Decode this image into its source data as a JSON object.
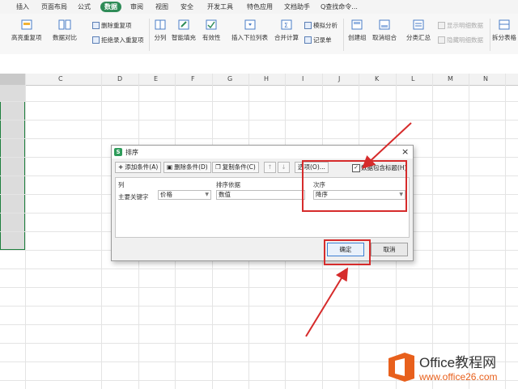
{
  "menu": {
    "items": [
      "插入",
      "页面布局",
      "公式",
      "数据",
      "审阅",
      "视图",
      "安全",
      "开发工具",
      "特色应用",
      "文档助手",
      "Q查找命令..."
    ],
    "active_index": 3
  },
  "ribbon": {
    "highlight_dup": "高亮重复项",
    "data_compare": "数据对比",
    "delete_dup": "删除重复项",
    "reject_dup": "拒绝录入重复项",
    "split": "分列",
    "smart_fill": "智能填充",
    "validity": "有效性",
    "insert_dropdown": "插入下拉列表",
    "merge_calc": "合并计算",
    "simulate": "模拟分析",
    "record": "记录单",
    "create_group": "创建组",
    "ungroup": "取消组合",
    "subtotal": "分类汇总",
    "show_detail": "显示明细数据",
    "hide_detail": "隐藏明细数据",
    "split_table": "拆分表格"
  },
  "columns": [
    "C",
    "D",
    "E",
    "F",
    "G",
    "H",
    "I",
    "J",
    "K",
    "L",
    "M",
    "N"
  ],
  "dialog": {
    "title": "排序",
    "logo": "S",
    "close": "×",
    "buttons": {
      "add": "添加条件(A)",
      "delete": "删除条件(D)",
      "copy": "复制条件(C)",
      "up": "↑",
      "down": "↓",
      "options": "选项(O)...",
      "header_checkbox": "数据包含标题(H)"
    },
    "headers": {
      "col": "列",
      "basis": "排序依据",
      "order": "次序"
    },
    "row": {
      "key_label": "主要关键字",
      "key_value": "价格",
      "basis_value": "数值",
      "order_value": "降序"
    },
    "ok": "确定",
    "cancel": "取消"
  },
  "watermark": {
    "brand": "Office教程网",
    "url": "www.office26.com"
  },
  "colors": {
    "active_tab": "#2e8b57",
    "annotation": "#d62b2b",
    "selection_border": "#1e7f3e",
    "watermark_orange": "#e8601c"
  }
}
